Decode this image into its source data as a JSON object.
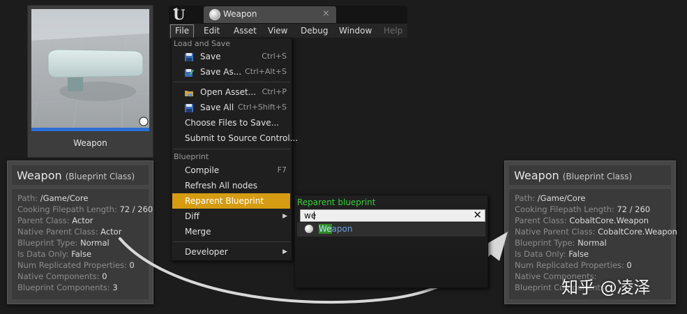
{
  "thumbnail": {
    "label": "Weapon"
  },
  "editor": {
    "tab": {
      "label": "Weapon",
      "close": "×"
    },
    "menubar": [
      "File",
      "Edit",
      "Asset",
      "View",
      "Debug",
      "Window",
      "Help"
    ]
  },
  "file_menu": {
    "section_load_save": "Load and Save",
    "save": {
      "label": "Save",
      "shortcut": "Ctrl+S"
    },
    "save_as": {
      "label": "Save As...",
      "shortcut": "Ctrl+Alt+S"
    },
    "open_asset": {
      "label": "Open Asset...",
      "shortcut": "Ctrl+P"
    },
    "save_all": {
      "label": "Save All",
      "shortcut": "Ctrl+Shift+S"
    },
    "choose_files": {
      "label": "Choose Files to Save..."
    },
    "submit_source": {
      "label": "Submit to Source Control..."
    },
    "section_blueprint": "Blueprint",
    "compile": {
      "label": "Compile",
      "shortcut": "F7"
    },
    "refresh_nodes": {
      "label": "Refresh All nodes"
    },
    "reparent": {
      "label": "Reparent Blueprint"
    },
    "diff": {
      "label": "Diff",
      "arrow": "▶"
    },
    "merge": {
      "label": "Merge"
    },
    "developer": {
      "label": "Developer",
      "arrow": "▶"
    }
  },
  "reparent_popup": {
    "title": "Reparent blueprint",
    "search_value": "we",
    "clear": "✕",
    "result_match": "We",
    "result_rest": "apon"
  },
  "left_card": {
    "title": "Weapon",
    "subtitle": "(Blueprint Class)",
    "rows": [
      {
        "k": "Path: ",
        "v": "/Game/Core"
      },
      {
        "k": "Cooking Filepath Length: ",
        "v": "72 / 260"
      },
      {
        "k": "Parent Class: ",
        "v": "Actor"
      },
      {
        "k": "Native Parent Class: ",
        "v": "Actor"
      },
      {
        "k": "Blueprint Type: ",
        "v": "Normal"
      },
      {
        "k": "Is Data Only: ",
        "v": "False"
      },
      {
        "k": "Num Replicated Properties: ",
        "v": "0"
      },
      {
        "k": "Native Components: ",
        "v": "0"
      },
      {
        "k": "Blueprint Components: ",
        "v": "3"
      }
    ]
  },
  "right_card": {
    "title": "Weapon",
    "subtitle": "(Blueprint Class)",
    "rows": [
      {
        "k": "Path: ",
        "v": "/Game/Core"
      },
      {
        "k": "Cooking Filepath Length: ",
        "v": "72 / 260"
      },
      {
        "k": "Parent Class: ",
        "v": "CobaltCore.Weapon"
      },
      {
        "k": "Native Parent Class: ",
        "v": "CobaltCore.Weapon"
      },
      {
        "k": "Blueprint Type: ",
        "v": "Normal"
      },
      {
        "k": "Is Data Only: ",
        "v": "False"
      },
      {
        "k": "Num Replicated Properties: ",
        "v": "0"
      },
      {
        "k": "Native Components: ",
        "v": ""
      },
      {
        "k": "Blueprint Components: ",
        "v": ""
      }
    ]
  },
  "watermark": "知乎 @凌泽",
  "colors": {
    "highlight": "#d59c12",
    "section_green": "#36d13a",
    "thumb_bar": "#2c6fd6",
    "arrow": "#d8d8d8"
  },
  "icons": {
    "save": "floppy-disk-icon",
    "save_as": "floppy-edit-icon",
    "open_asset": "open-folder-icon",
    "save_all": "floppy-disk-icon",
    "blueprint": "sphere-icon",
    "logo": "unreal-logo-icon"
  }
}
